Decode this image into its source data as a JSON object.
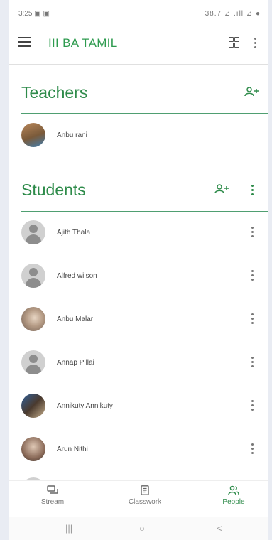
{
  "status_bar": {
    "time": "3:25 ▣ ▣",
    "system": "38.7 ⊿ .ıll ⊿ ●"
  },
  "app_bar": {
    "title": "III BA TAMIL"
  },
  "teachers": {
    "title": "Teachers",
    "list": [
      {
        "name": "Anbu rani"
      }
    ]
  },
  "students": {
    "title": "Students",
    "list": [
      {
        "name": "Ajith Thala"
      },
      {
        "name": "Alfred wilson"
      },
      {
        "name": "Anbu Malar"
      },
      {
        "name": "Annap Pillai"
      },
      {
        "name": "Annikuty Annikuty"
      },
      {
        "name": "Arun Nithi"
      }
    ]
  },
  "bottom_nav": {
    "stream": "Stream",
    "classwork": "Classwork",
    "people": "People"
  },
  "colors": {
    "accent": "#2e8b4a"
  },
  "system_nav": {
    "recent": "|||",
    "home": "○",
    "back": "<"
  }
}
